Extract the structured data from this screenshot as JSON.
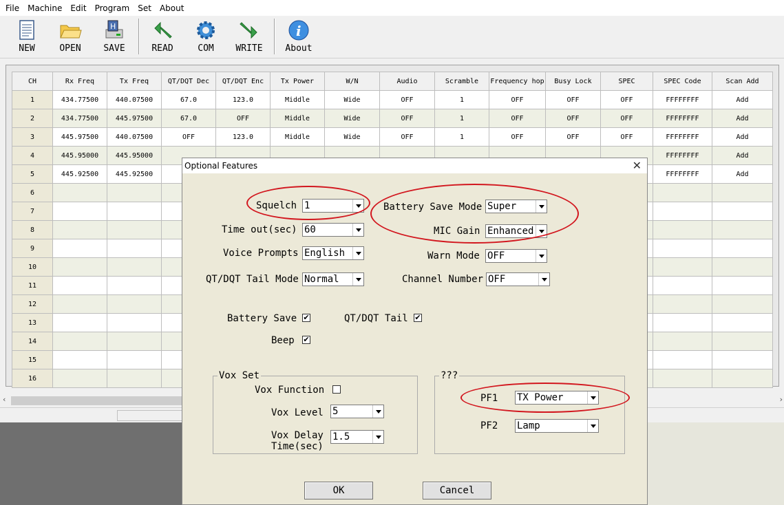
{
  "menu": [
    "File",
    "Machine",
    "Edit",
    "Program",
    "Set",
    "About"
  ],
  "toolbar": {
    "buttons": [
      {
        "label": "NEW",
        "icon": "new-document-icon"
      },
      {
        "label": "OPEN",
        "icon": "open-folder-icon"
      },
      {
        "label": "SAVE",
        "icon": "save-disk-icon"
      },
      {
        "label": "READ",
        "icon": "read-arrow-icon"
      },
      {
        "label": "COM",
        "icon": "com-gear-icon"
      },
      {
        "label": "WRITE",
        "icon": "write-arrow-icon"
      },
      {
        "label": "About",
        "icon": "info-icon"
      }
    ]
  },
  "grid": {
    "columns": [
      "CH",
      "Rx Freq",
      "Tx Freq",
      "QT/DQT Dec",
      "QT/DQT Enc",
      "Tx Power",
      "W/N",
      "Audio",
      "Scramble",
      "Frequency hop",
      "Busy Lock",
      "SPEC",
      "SPEC Code",
      "Scan Add"
    ],
    "rows": [
      [
        "1",
        "434.77500",
        "440.07500",
        "67.0",
        "123.0",
        "Middle",
        "Wide",
        "OFF",
        "1",
        "OFF",
        "OFF",
        "OFF",
        "FFFFFFFF",
        "Add"
      ],
      [
        "2",
        "434.77500",
        "445.97500",
        "67.0",
        "OFF",
        "Middle",
        "Wide",
        "OFF",
        "1",
        "OFF",
        "OFF",
        "OFF",
        "FFFFFFFF",
        "Add"
      ],
      [
        "3",
        "445.97500",
        "440.07500",
        "OFF",
        "123.0",
        "Middle",
        "Wide",
        "OFF",
        "1",
        "OFF",
        "OFF",
        "OFF",
        "FFFFFFFF",
        "Add"
      ],
      [
        "4",
        "445.95000",
        "445.95000",
        "",
        "",
        "",
        "",
        "",
        "",
        "",
        "",
        "",
        "FFFFFFFF",
        "Add"
      ],
      [
        "5",
        "445.92500",
        "445.92500",
        "",
        "",
        "",
        "",
        "",
        "",
        "",
        "",
        "",
        "FFFFFFFF",
        "Add"
      ],
      [
        "6",
        "",
        "",
        "",
        "",
        "",
        "",
        "",
        "",
        "",
        "",
        "",
        "",
        ""
      ],
      [
        "7",
        "",
        "",
        "",
        "",
        "",
        "",
        "",
        "",
        "",
        "",
        "",
        "",
        ""
      ],
      [
        "8",
        "",
        "",
        "",
        "",
        "",
        "",
        "",
        "",
        "",
        "",
        "",
        "",
        ""
      ],
      [
        "9",
        "",
        "",
        "",
        "",
        "",
        "",
        "",
        "",
        "",
        "",
        "",
        "",
        ""
      ],
      [
        "10",
        "",
        "",
        "",
        "",
        "",
        "",
        "",
        "",
        "",
        "",
        "",
        "",
        ""
      ],
      [
        "11",
        "",
        "",
        "",
        "",
        "",
        "",
        "",
        "",
        "",
        "",
        "",
        "",
        ""
      ],
      [
        "12",
        "",
        "",
        "",
        "",
        "",
        "",
        "",
        "",
        "",
        "",
        "",
        "",
        ""
      ],
      [
        "13",
        "",
        "",
        "",
        "",
        "",
        "",
        "",
        "",
        "",
        "",
        "",
        "",
        ""
      ],
      [
        "14",
        "",
        "",
        "",
        "",
        "",
        "",
        "",
        "",
        "",
        "",
        "",
        "",
        ""
      ],
      [
        "15",
        "",
        "",
        "",
        "",
        "",
        "",
        "",
        "",
        "",
        "",
        "",
        "",
        ""
      ],
      [
        "16",
        "",
        "",
        "",
        "",
        "",
        "",
        "",
        "",
        "",
        "",
        "",
        "",
        ""
      ]
    ]
  },
  "dialog": {
    "title": "Optional Features",
    "squelch": {
      "label": "Squelch",
      "value": "1"
    },
    "timeout": {
      "label": "Time out(sec)",
      "value": "60"
    },
    "voice_prompts": {
      "label": "Voice Prompts",
      "value": "English"
    },
    "tail_mode": {
      "label": "QT/DQT Tail Mode",
      "value": "Normal"
    },
    "battery_save_mode": {
      "label": "Battery Save Mode",
      "value": "Super"
    },
    "mic_gain": {
      "label": "MIC Gain",
      "value": "Enhanced"
    },
    "warn_mode": {
      "label": "Warn Mode",
      "value": "OFF"
    },
    "channel_number": {
      "label": "Channel Number",
      "value": "OFF"
    },
    "battery_save": {
      "label": "Battery Save",
      "checked": true
    },
    "qt_tail": {
      "label": "QT/DQT Tail",
      "checked": true
    },
    "beep": {
      "label": "Beep",
      "checked": true
    },
    "vox": {
      "title": "Vox Set",
      "function_label": "Vox Function",
      "function_checked": false,
      "level_label": "Vox Level",
      "level_value": "5",
      "delay_label_1": "Vox Delay",
      "delay_label_2": "Time(sec)",
      "delay_value": "1.5"
    },
    "pf": {
      "title": "???",
      "pf1_label": "PF1",
      "pf1_value": "TX Power",
      "pf2_label": "PF2",
      "pf2_value": "Lamp"
    },
    "ok_label": "OK",
    "cancel_label": "Cancel",
    "check_glyph": "✔"
  },
  "colors": {
    "highlight_ellipse": "#d2161e"
  }
}
